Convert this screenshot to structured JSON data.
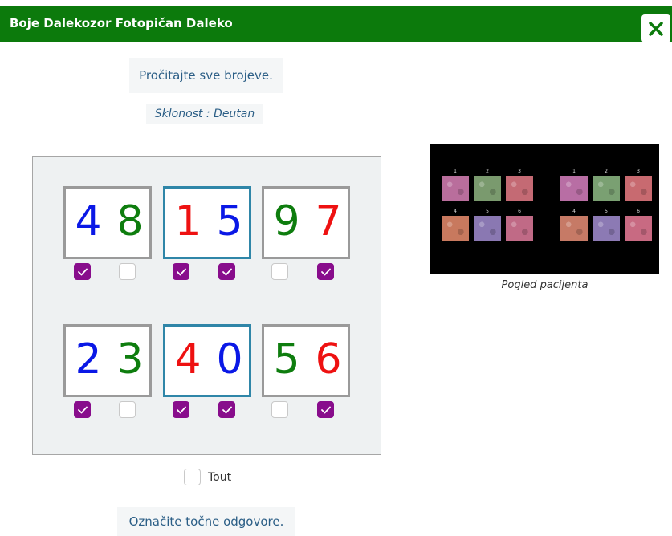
{
  "header": {
    "title": "Boje Dalekozor Fotopičan Daleko",
    "close_icon": "close-icon"
  },
  "instruction": "Pročitajte sve brojeve.",
  "tendency": "Sklonost : Deutan",
  "colors": {
    "header_bg": "#0c7a0c",
    "blue": "#0a18e6",
    "green": "#0e7d0e",
    "red": "#ee1111",
    "checkbox_on": "#880d8c",
    "selected_border": "#2f86a8",
    "text_blue": "#2b5e86"
  },
  "cards": [
    {
      "digits": [
        {
          "text": "4",
          "color": "blue",
          "checked": true
        },
        {
          "text": "8",
          "color": "green",
          "checked": false
        }
      ],
      "selected": false
    },
    {
      "digits": [
        {
          "text": "1",
          "color": "red",
          "checked": true
        },
        {
          "text": "5",
          "color": "blue",
          "checked": true
        }
      ],
      "selected": true
    },
    {
      "digits": [
        {
          "text": "9",
          "color": "green",
          "checked": false
        },
        {
          "text": "7",
          "color": "red",
          "checked": true
        }
      ],
      "selected": false
    },
    {
      "digits": [
        {
          "text": "2",
          "color": "blue",
          "checked": true
        },
        {
          "text": "3",
          "color": "green",
          "checked": false
        }
      ],
      "selected": false
    },
    {
      "digits": [
        {
          "text": "4",
          "color": "red",
          "checked": true
        },
        {
          "text": "0",
          "color": "blue",
          "checked": true
        }
      ],
      "selected": true
    },
    {
      "digits": [
        {
          "text": "5",
          "color": "green",
          "checked": false
        },
        {
          "text": "6",
          "color": "red",
          "checked": true
        }
      ],
      "selected": false
    }
  ],
  "preview": {
    "caption": "Pogled pacijenta",
    "groups": [
      {
        "labels": [
          "1",
          "2",
          "3",
          "4",
          "5",
          "6"
        ],
        "tints": [
          "#b96e9c",
          "#7a9a6e",
          "#c46a74",
          "#c8795e",
          "#8a78b2",
          "#c06a86"
        ]
      },
      {
        "labels": [
          "1",
          "2",
          "3",
          "4",
          "5",
          "6"
        ],
        "tints": [
          "#b86ea4",
          "#7aa072",
          "#c86a70",
          "#c67a66",
          "#8c7ab4",
          "#c86a82"
        ]
      }
    ]
  },
  "tout": {
    "label": "Tout",
    "checked": false
  },
  "mark_correct": "Označite točne odgovore."
}
